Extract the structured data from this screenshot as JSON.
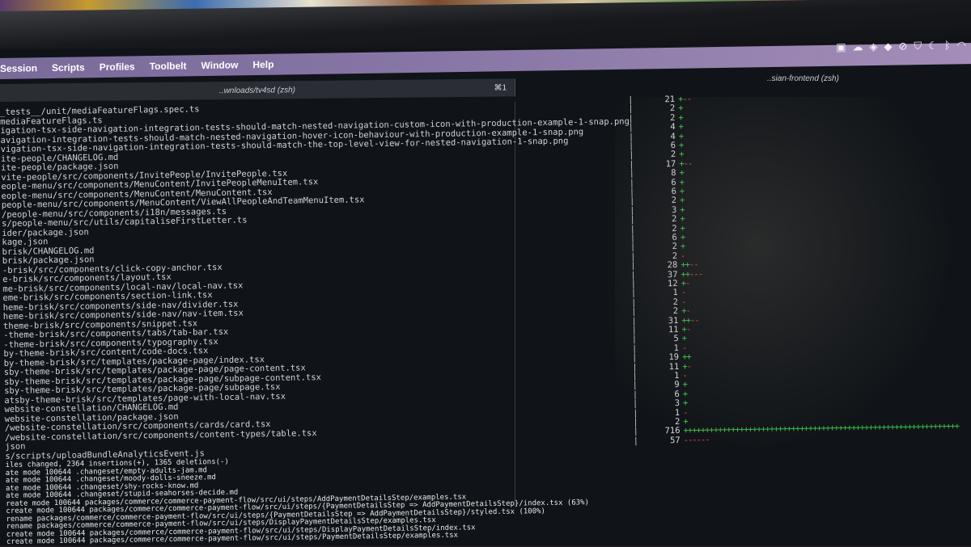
{
  "menubar": {
    "items": [
      "Session",
      "Scripts",
      "Profiles",
      "Toolbelt",
      "Window",
      "Help"
    ]
  },
  "left_pane": {
    "title": "..wnloads/tv4sd (zsh)",
    "shortcut": "⌘1"
  },
  "right_pane": {
    "title": "..sian-frontend (zsh)"
  },
  "tray_icons": [
    "camera-icon",
    "cloud-icon",
    "app-icon",
    "dropbox-icon",
    "block-icon",
    "shield-icon",
    "moon-icon",
    "bluetooth-icon",
    "wifi-icon"
  ],
  "terminal_lines": [
    "_tests__/unit/mediaFeatureFlags.spec.ts",
    "mediaFeatureFlags.ts",
    "igation-tsx-side-navigation-integration-tests-should-match-nested-navigation-custom-icon-with-production-example-1-snap.png",
    "avigation-integration-tests-should-match-nested-navigation-hover-icon-behaviour-with-production-example-1-snap.png",
    "vigation-tsx-side-navigation-integration-tests-should-match-the-top-level-view-for-nested-navigation-1-snap.png",
    "ite-people/CHANGELOG.md",
    "ite-people/package.json",
    "vite-people/src/components/InvitePeople/InvitePeople.tsx",
    "eople-menu/src/components/MenuContent/InvitePeopleMenuItem.tsx",
    "eople-menu/src/components/MenuContent/MenuContent.tsx",
    "people-menu/src/components/MenuContent/ViewAllPeopleAndTeamMenuItem.tsx",
    "/people-menu/src/components/i18n/messages.ts",
    "s/people-menu/src/utils/capitaliseFirstLetter.ts",
    "ider/package.json",
    "kage.json",
    "brisk/CHANGELOG.md",
    "brisk/package.json",
    "-brisk/src/components/click-copy-anchor.tsx",
    "e-brisk/src/components/layout.tsx",
    "me-brisk/src/components/local-nav/local-nav.tsx",
    "eme-brisk/src/components/section-link.tsx",
    "heme-brisk/src/components/side-nav/divider.tsx",
    "heme-brisk/src/components/side-nav/nav-item.tsx",
    "theme-brisk/src/components/snippet.tsx",
    "-theme-brisk/src/components/tabs/tab-bar.tsx",
    "-theme-brisk/src/components/typography.tsx",
    "by-theme-brisk/src/content/code-docs.tsx",
    "by-theme-brisk/src/templates/package-page/index.tsx",
    "sby-theme-brisk/src/templates/package-page/page-content.tsx",
    "sby-theme-brisk/src/templates/package-page/subpage-content.tsx",
    "sby-theme-brisk/src/templates/package-page/subpage.tsx",
    "atsby-theme-brisk/src/templates/page-with-local-nav.tsx",
    "website-constellation/CHANGELOG.md",
    "website-constellation/package.json",
    "/website-constellation/src/components/cards/card.tsx",
    "/website-constellation/src/components/content-types/table.tsx",
    "json",
    "s/scripts/uploadBundleAnalyticsEvent.js",
    "iles changed, 2364 insertions(+), 1365 deletions(-)",
    "ate mode 100644 .changeset/empty-adults-jam.md",
    "ate mode 100644 .changeset/moody-dolls-sneeze.md",
    "ate mode 100644 .changeset/shy-rocks-know.md",
    "ate mode 100644 .changeset/stupid-seahorses-decide.md",
    "reate mode 100644 packages/commerce/commerce-payment-flow/src/ui/steps/AddPaymentDetailsStep/examples.tsx",
    "create mode 100644 packages/commerce/commerce-payment-flow/src/ui/steps/{PaymentDetailsStep => AddPaymentDetailsStep}/index.tsx (63%)",
    "rename packages/commerce/commerce-payment-flow/src/ui/steps/{PaymentDetailsStep => AddPaymentDetailsStep}/styled.tsx (100%)",
    "rename packages/commerce/commerce-payment-flow/src/ui/steps/DisplayPaymentDetailsStep/examples.tsx",
    "create mode 100644 packages/commerce/commerce-payment-flow/src/ui/steps/DisplayPaymentDetailsStep/index.tsx",
    "create mode 100644 packages/commerce/commerce-payment-flow/src/ui/steps/PaymentDetailsStep/examples.tsx"
  ],
  "diff_stats": [
    {
      "count": "21",
      "plus": "+",
      "minus": "--"
    },
    {
      "count": "2",
      "plus": "+",
      "minus": ""
    },
    {
      "count": "2",
      "plus": "+",
      "minus": ""
    },
    {
      "count": "4",
      "plus": "+",
      "minus": ""
    },
    {
      "count": "4",
      "plus": "+",
      "minus": ""
    },
    {
      "count": "6",
      "plus": "+",
      "minus": ""
    },
    {
      "count": "2",
      "plus": "+",
      "minus": ""
    },
    {
      "count": "17",
      "plus": "+",
      "minus": "--"
    },
    {
      "count": "8",
      "plus": "+",
      "minus": ""
    },
    {
      "count": "6",
      "plus": "+",
      "minus": ""
    },
    {
      "count": "6",
      "plus": "+",
      "minus": ""
    },
    {
      "count": "2",
      "plus": "+",
      "minus": ""
    },
    {
      "count": "3",
      "plus": "+",
      "minus": ""
    },
    {
      "count": "2",
      "plus": "+",
      "minus": ""
    },
    {
      "count": "2",
      "plus": "+",
      "minus": ""
    },
    {
      "count": "6",
      "plus": "+",
      "minus": ""
    },
    {
      "count": "2",
      "plus": "+",
      "minus": ""
    },
    {
      "count": "2",
      "plus": "",
      "minus": "-"
    },
    {
      "count": "28",
      "plus": "++",
      "minus": "--"
    },
    {
      "count": "37",
      "plus": "++",
      "minus": "---"
    },
    {
      "count": "12",
      "plus": "+",
      "minus": "-"
    },
    {
      "count": "1",
      "plus": "",
      "minus": "-"
    },
    {
      "count": "2",
      "plus": "",
      "minus": "-"
    },
    {
      "count": "2",
      "plus": "+",
      "minus": "-"
    },
    {
      "count": "31",
      "plus": "++",
      "minus": "--"
    },
    {
      "count": "11",
      "plus": "+",
      "minus": "-"
    },
    {
      "count": "5",
      "plus": "+",
      "minus": ""
    },
    {
      "count": "1",
      "plus": "",
      "minus": "-"
    },
    {
      "count": "19",
      "plus": "++",
      "minus": ""
    },
    {
      "count": "11",
      "plus": "+",
      "minus": "-"
    },
    {
      "count": "1",
      "plus": "",
      "minus": "-"
    },
    {
      "count": "9",
      "plus": "+",
      "minus": ""
    },
    {
      "count": "6",
      "plus": "+",
      "minus": ""
    },
    {
      "count": "3",
      "plus": "+",
      "minus": ""
    },
    {
      "count": "1",
      "plus": "",
      "minus": "-"
    },
    {
      "count": "2",
      "plus": "+",
      "minus": ""
    },
    {
      "count": "716",
      "plus": "++++++++++++++++++++++++++++++++++++++++++++++++++++++++++++++++",
      "minus": ""
    },
    {
      "count": "57",
      "plus": "",
      "minus": "------"
    }
  ],
  "colors": {
    "plus": "#3ccf4e",
    "minus": "#e0474c",
    "menubar": "#8b7aa8",
    "terminal_bg": "#101418"
  }
}
